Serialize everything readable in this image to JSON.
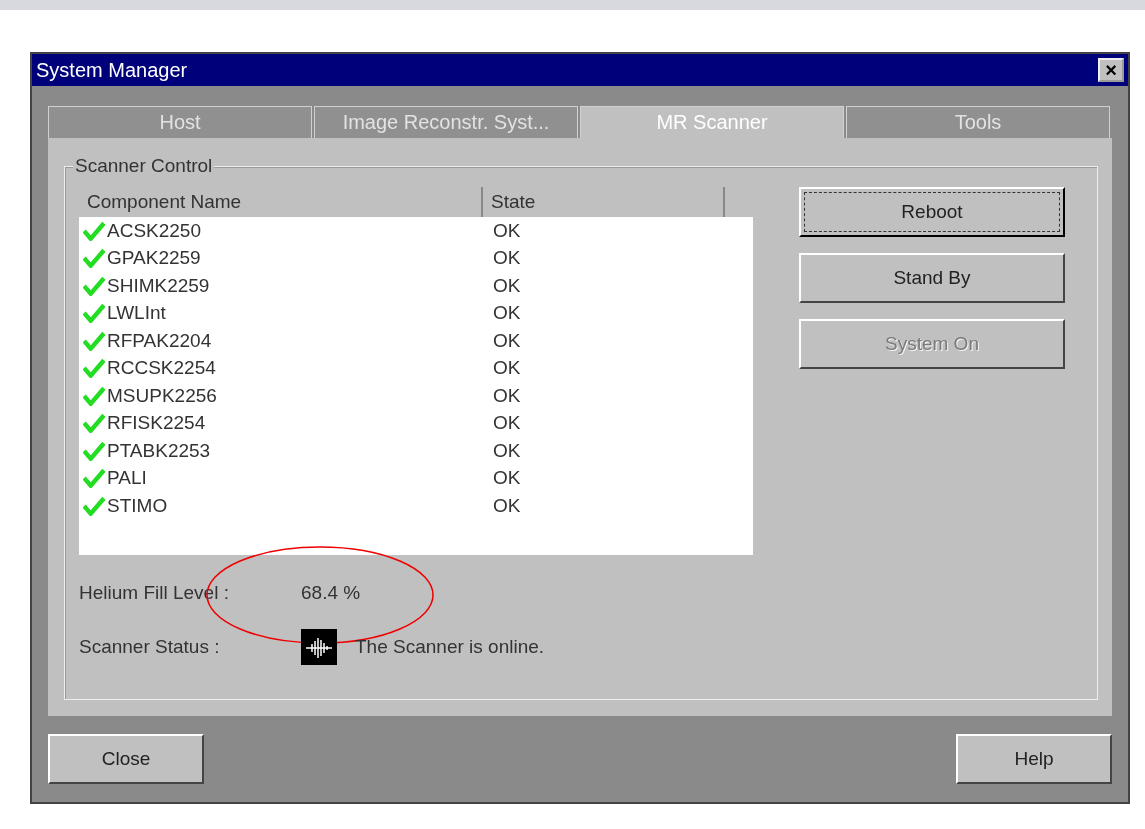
{
  "window": {
    "title": "System Manager",
    "close_glyph": "×"
  },
  "tabs": [
    {
      "label": "Host",
      "selected": false,
      "disabled": true
    },
    {
      "label": "Image Reconstr. Syst...",
      "selected": false,
      "disabled": true
    },
    {
      "label": "MR Scanner",
      "selected": true,
      "disabled": false
    },
    {
      "label": "Tools",
      "selected": false,
      "disabled": true
    }
  ],
  "group": {
    "title": "Scanner Control"
  },
  "table": {
    "columns": [
      "Component Name",
      "State"
    ],
    "rows": [
      {
        "name": "ACSK2250",
        "state": "OK",
        "ok": true
      },
      {
        "name": "GPAK2259",
        "state": "OK",
        "ok": true
      },
      {
        "name": "SHIMK2259",
        "state": "OK",
        "ok": true
      },
      {
        "name": "LWLInt",
        "state": "OK",
        "ok": true
      },
      {
        "name": "RFPAK2204",
        "state": "OK",
        "ok": true
      },
      {
        "name": "RCCSK2254",
        "state": "OK",
        "ok": true
      },
      {
        "name": "MSUPK2256",
        "state": "OK",
        "ok": true
      },
      {
        "name": "RFISK2254",
        "state": "OK",
        "ok": true
      },
      {
        "name": "PTABK2253",
        "state": "OK",
        "ok": true
      },
      {
        "name": "PALI",
        "state": "OK",
        "ok": true
      },
      {
        "name": "STIMO",
        "state": "OK",
        "ok": true
      }
    ]
  },
  "side_buttons": [
    {
      "label": "Reboot",
      "disabled": false,
      "focused": true
    },
    {
      "label": "Stand By",
      "disabled": false,
      "focused": false
    },
    {
      "label": "System On",
      "disabled": true,
      "focused": false
    }
  ],
  "helium": {
    "label": "Helium Fill Level :",
    "value": "68.4 %",
    "highlighted": true
  },
  "status": {
    "label": "Scanner Status :",
    "value": "The Scanner is online."
  },
  "footer_buttons": [
    "Close",
    "Help"
  ]
}
